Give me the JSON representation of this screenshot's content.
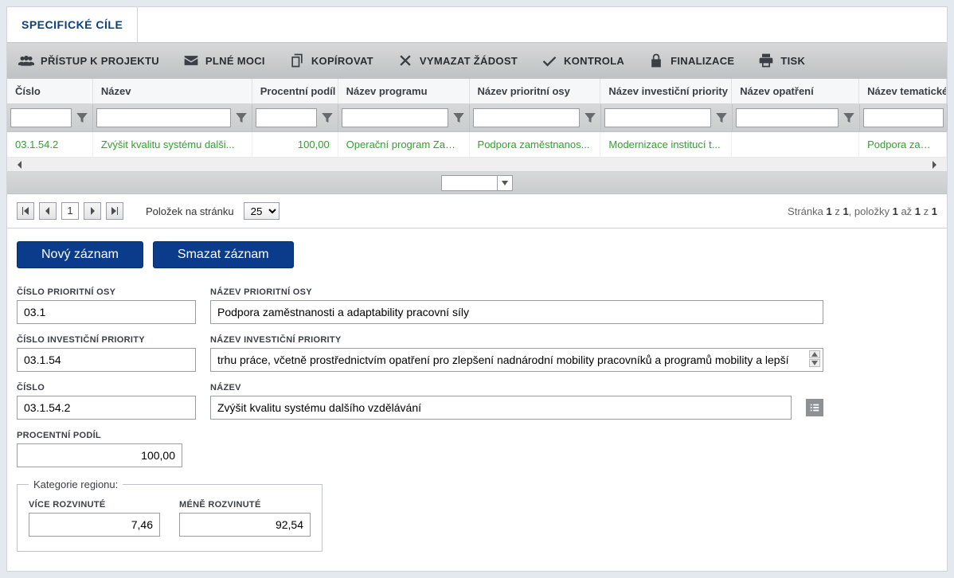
{
  "tab": {
    "title": "SPECIFICKÉ CÍLE"
  },
  "toolbar": {
    "access": "PŘÍSTUP K PROJEKTU",
    "powers": "PLNÉ MOCI",
    "copy": "KOPÍROVAT",
    "delete": "VYMAZAT ŽÁDOST",
    "check": "KONTROLA",
    "finalize": "FINALIZACE",
    "print": "TISK"
  },
  "grid": {
    "headers": {
      "num": "Číslo",
      "name": "Název",
      "pct": "Procentní podíl",
      "prog": "Název programu",
      "axis": "Název prioritní osy",
      "inv": "Název investiční priority",
      "mea": "Název opatření",
      "theme": "Název tematického"
    },
    "row": {
      "num": "03.1.54.2",
      "name": "Zvýšit kvalitu systému dalši...",
      "pct": "100,00",
      "prog": "Operační program Zam...",
      "axis": "Podpora zaměstnanos...",
      "inv": "Modernizace institucí t...",
      "mea": "",
      "theme": "Podpora zaměs"
    }
  },
  "pager": {
    "current": "1",
    "per_label": "Položek na stránku",
    "per_value": "25",
    "status_prefix": "Stránka ",
    "p1": "1",
    "of": " z ",
    "p2": "1",
    "items": ", položky ",
    "i1": "1",
    "to": " až ",
    "i2": "1",
    "of2": " z ",
    "i3": "1"
  },
  "actions": {
    "new": "Nový záznam",
    "delete": "Smazat záznam"
  },
  "form": {
    "axis_num_label": "ČÍSLO PRIORITNÍ OSY",
    "axis_num": "03.1",
    "axis_name_label": "NÁZEV PRIORITNÍ OSY",
    "axis_name": "Podpora zaměstnanosti a adaptability pracovní síly",
    "inv_num_label": "ČÍSLO INVESTIČNÍ PRIORITY",
    "inv_num": "03.1.54",
    "inv_name_label": "NÁZEV INVESTIČNÍ PRIORITY",
    "inv_name": "trhu práce, včetně prostřednictvím opatření pro zlepšení nadnárodní mobility pracovníků a programů mobility a lepší",
    "num_label": "ČÍSLO",
    "num": "03.1.54.2",
    "name_label": "NÁZEV",
    "name": "Zvýšit kvalitu systému dalšího vzdělávání",
    "pct_label": "PROCENTNÍ PODÍL",
    "pct": "100,00"
  },
  "region": {
    "legend": "Kategorie regionu:",
    "more_label": "VÍCE ROZVINUTÉ",
    "more": "7,46",
    "less_label": "MÉNĚ ROZVINUTÉ",
    "less": "92,54"
  }
}
